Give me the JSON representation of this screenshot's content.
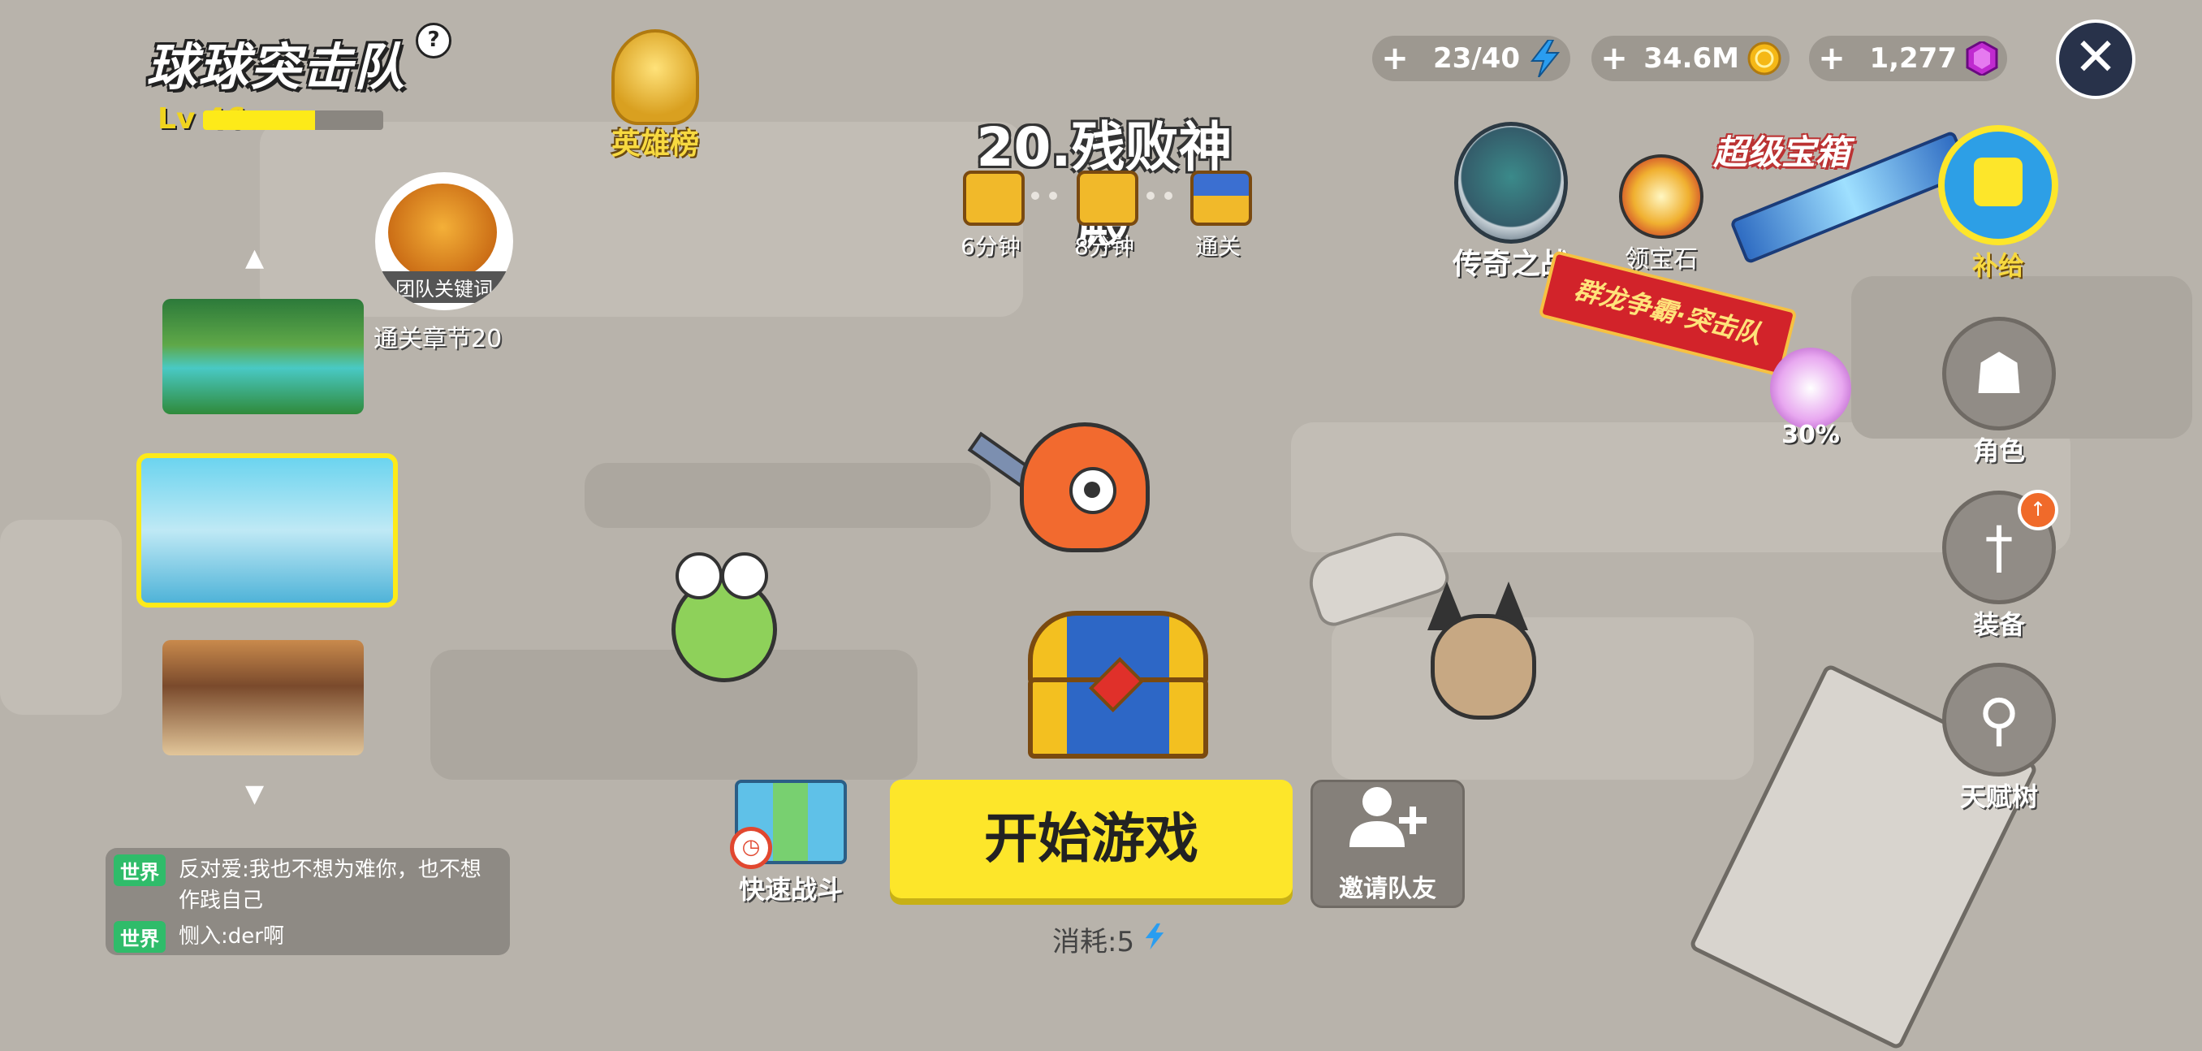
{
  "header": {
    "logo_text": "球球突击队",
    "help_symbol": "?",
    "level_label": "Lv",
    "level_value": "46",
    "level_progress": 0.62,
    "hero_board_label": "英雄榜"
  },
  "stage": {
    "title": "20.残败神殿",
    "rewards": [
      {
        "label": "6分钟"
      },
      {
        "label": "8分钟"
      },
      {
        "label": "通关"
      }
    ]
  },
  "currency": {
    "energy": {
      "plus": "+",
      "value": "23/40",
      "icon": "lightning-icon",
      "color": "#2a9df0"
    },
    "gold": {
      "plus": "+",
      "value": "34.6M",
      "icon": "coin-icon",
      "color": "#f5b816"
    },
    "gems": {
      "plus": "+",
      "value": "1,277",
      "icon": "gem-icon",
      "color": "#c02ad0"
    },
    "close_symbol": "✕"
  },
  "left_panel": {
    "up_arrow": "▲",
    "down_arrow": "▼",
    "team_key_label": "团队关键词",
    "chapter_label": "通关章节20"
  },
  "chat": {
    "messages": [
      {
        "tag": "世界",
        "text": "反对爱:我也不想为难你，也不想作践自己"
      },
      {
        "tag": "世界",
        "text": "恻入:der啊"
      }
    ]
  },
  "bottom": {
    "quick_battle_label": "快速战斗",
    "start_label": "开始游戏",
    "invite_label": "邀请队友",
    "cost_label": "消耗:5",
    "cost_icon": "lightning-icon"
  },
  "events": {
    "legend_label": "传奇之战",
    "gem_claim_label": "领宝石",
    "super_shop_title": "超级宝箱",
    "supply_label": "补给",
    "banner_text": "群龙争霸·突击队",
    "key_percent": "30%"
  },
  "side_menu": [
    {
      "label": "角色",
      "icon": "character-icon",
      "glyph": "☗"
    },
    {
      "label": "装备",
      "icon": "sword-icon",
      "glyph": "†"
    },
    {
      "label": "天赋树",
      "icon": "talent-tree-icon",
      "glyph": "⚲"
    }
  ],
  "colors": {
    "accent_yellow": "#fde62a",
    "chat_tag_green": "#2fbc6a",
    "close_button": "#28324a"
  }
}
